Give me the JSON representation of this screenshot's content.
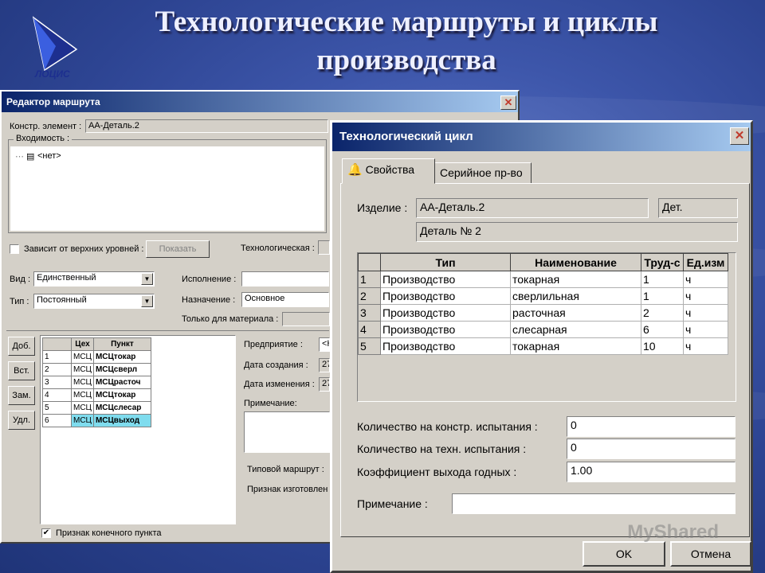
{
  "slide": {
    "title_line1": "Технологические маршруты и циклы",
    "title_line2": "производства"
  },
  "route_editor": {
    "title": "Редактор маршрута",
    "konstr_label": "Констр. элемент :",
    "konstr_value": "АА-Деталь.2",
    "vhodimost_label": "Входимость :",
    "tree_item": "<нет>",
    "depends_label": "Зависит от верхних уровней :",
    "show_button": "Показать",
    "tech_label": "Технологическая :",
    "vid_label": "Вид :",
    "vid_value": "Единственный",
    "tip_label": "Тип :",
    "tip_value": "Постоянный",
    "ispolnenie_label": "Исполнение :",
    "naznachenie_label": "Назначение :",
    "naznachenie_value": "Основное",
    "only_material_label": "Только для материала :",
    "buttons": {
      "add": "Доб.",
      "insert": "Вст.",
      "replace": "Зам.",
      "delete": "Удл."
    },
    "table": {
      "headers": [
        "",
        "Цех",
        "Пункт"
      ],
      "rows": [
        {
          "n": "1",
          "ceh": "МСЦ",
          "punkt": "МСЦтокар"
        },
        {
          "n": "2",
          "ceh": "МСЦ",
          "punkt": "МСЦсверл"
        },
        {
          "n": "3",
          "ceh": "МСЦ",
          "punkt": "МСЦрасточ"
        },
        {
          "n": "4",
          "ceh": "МСЦ",
          "punkt": "МСЦтокар"
        },
        {
          "n": "5",
          "ceh": "МСЦ",
          "punkt": "МСЦслесар"
        },
        {
          "n": "6",
          "ceh": "МСЦ",
          "punkt": "МСЦвыход"
        }
      ]
    },
    "predpriyatie_label": "Предприятие :",
    "predpriyatie_value": "<Н",
    "date_created_label": "Дата создания :",
    "date_created_value": "27",
    "date_changed_label": "Дата изменения :",
    "date_changed_value": "27",
    "note_label": "Примечание:",
    "typical_route_label": "Типовой маршрут :",
    "manufact_label": "Признак изготовлен",
    "final_point_label": "Признак конечного пункта",
    "final_point_checked": "✔"
  },
  "cycle": {
    "title": "Технологический цикл",
    "tab_properties": "Свойства",
    "tab_serial": "Серийное пр-во",
    "izdelie_label": "Изделие :",
    "izdelie_value": "АА-Деталь.2",
    "izdelie_type": "Дет.",
    "izdelie_name": "Деталь № 2",
    "table": {
      "headers": [
        "",
        "Тип",
        "Наименование",
        "Труд-с",
        "Ед.изм"
      ],
      "rows": [
        {
          "n": "1",
          "tip": "Производство",
          "name": "токарная",
          "trud": "1",
          "ed": "ч"
        },
        {
          "n": "2",
          "tip": "Производство",
          "name": "сверлильная",
          "trud": "1",
          "ed": "ч"
        },
        {
          "n": "3",
          "tip": "Производство",
          "name": "расточная",
          "trud": "2",
          "ed": "ч"
        },
        {
          "n": "4",
          "tip": "Производство",
          "name": "слесарная",
          "trud": "6",
          "ed": "ч"
        },
        {
          "n": "5",
          "tip": "Производство",
          "name": "токарная",
          "trud": "10",
          "ed": "ч"
        }
      ]
    },
    "qty_konstr_label": "Количество на констр. испытания :",
    "qty_konstr_value": "0",
    "qty_tech_label": "Количество на техн. испытания :",
    "qty_tech_value": "0",
    "coef_label": "Коэффициент выхода годных :",
    "coef_value": "1.00",
    "note_label": "Примечание :",
    "ok": "OK",
    "cancel": "Отмена",
    "watermark": "MyShared"
  }
}
